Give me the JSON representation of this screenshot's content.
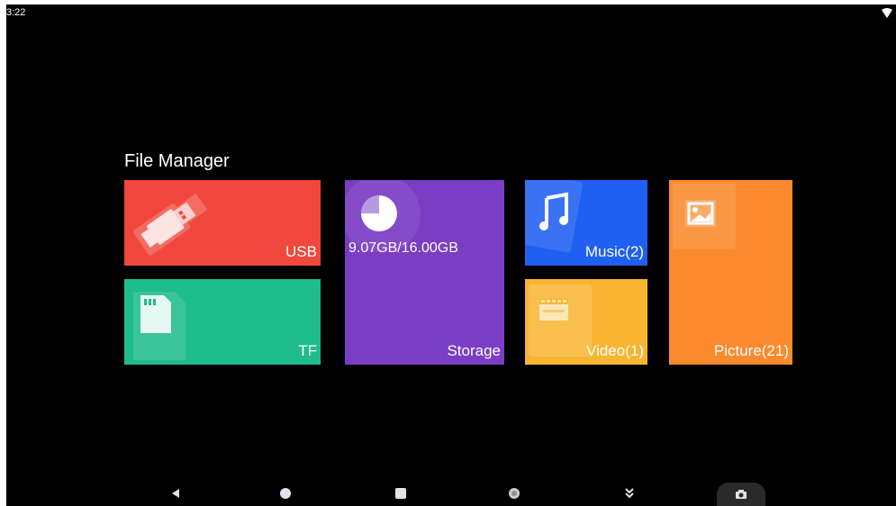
{
  "status_bar": {
    "time": "3:22",
    "wifi_icon": "wifi-icon"
  },
  "file_manager": {
    "title": "File Manager",
    "tiles": {
      "usb": {
        "label": "USB",
        "icon": "usb-drive-icon",
        "color": "#f0483c"
      },
      "tf": {
        "label": "TF",
        "icon": "sd-card-icon",
        "color": "#1fbc8c"
      },
      "storage": {
        "label": "Storage",
        "usage": "9.07GB/16.00GB",
        "icon": "storage-pie-icon",
        "color": "#7a3dc4"
      },
      "music": {
        "label": "Music(2)",
        "icon": "music-note-icon",
        "color": "#1f5ff2"
      },
      "video": {
        "label": "Video(1)",
        "icon": "video-icon",
        "color": "#f9b531"
      },
      "picture": {
        "label": "Picture(21)",
        "icon": "picture-icon",
        "color": "#fb8a2e"
      }
    }
  },
  "nav_bar": {
    "buttons": [
      {
        "icon": "back-icon"
      },
      {
        "icon": "home-icon"
      },
      {
        "icon": "recents-icon"
      },
      {
        "icon": "volume-icon"
      },
      {
        "icon": "hide-bar-icon"
      },
      {
        "icon": "screenshot-icon"
      }
    ]
  }
}
